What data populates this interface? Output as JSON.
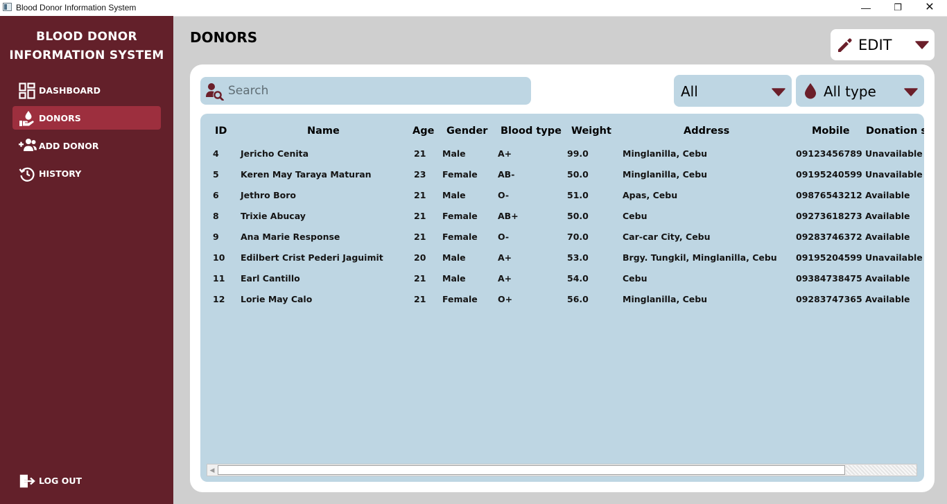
{
  "window": {
    "title": "Blood Donor Information System",
    "minimize_glyph": "—",
    "maximize_glyph": "❐",
    "close_glyph": "✕"
  },
  "sidebar": {
    "brand_line1": "BLOOD DONOR",
    "brand_line2": "INFORMATION SYSTEM",
    "items": [
      {
        "label": "DASHBOARD",
        "icon": "dashboard-icon"
      },
      {
        "label": "DONORS",
        "icon": "donor-hand-icon",
        "active": true
      },
      {
        "label": "ADD DONOR",
        "icon": "add-user-icon"
      },
      {
        "label": "HISTORY",
        "icon": "history-icon"
      }
    ],
    "logout": {
      "label": "LOG OUT",
      "icon": "logout-icon"
    }
  },
  "main": {
    "title": "DONORS",
    "edit": {
      "label": "EDIT",
      "icon": "pencil-icon"
    },
    "search": {
      "placeholder": "Search",
      "value": ""
    },
    "status_filter": {
      "value": "All"
    },
    "blood_filter": {
      "value": "All type",
      "icon": "blood-drop-icon"
    }
  },
  "table": {
    "columns": [
      "ID",
      "Name",
      "Age",
      "Gender",
      "Blood type",
      "Weight",
      "Address",
      "Mobile",
      "Donation s"
    ],
    "rows": [
      [
        "4",
        "Jericho  Cenita",
        "21",
        "Male",
        "A+",
        "99.0",
        "Minglanilla, Cebu",
        "09123456789",
        "Unavailable"
      ],
      [
        "5",
        "Keren May Taraya Maturan",
        "23",
        "Female",
        "AB-",
        "50.0",
        "Minglanilla, Cebu",
        "09195240599",
        "Unavailable"
      ],
      [
        "6",
        "Jethro  Boro",
        "21",
        "Male",
        "O-",
        "51.0",
        "Apas, Cebu",
        "09876543212",
        "Available"
      ],
      [
        "8",
        "Trixie  Abucay",
        "21",
        "Female",
        "AB+",
        "50.0",
        "Cebu",
        "09273618273",
        "Available"
      ],
      [
        "9",
        "Ana Marie  Response",
        "21",
        "Female",
        "O-",
        "70.0",
        "Car-car City, Cebu",
        "09283746372",
        "Available"
      ],
      [
        "10",
        "Edilbert Crist Pederi Jaguimit",
        "20",
        "Male",
        "A+",
        "53.0",
        "Brgy. Tungkil, Minglanilla, Cebu",
        "09195204599",
        "Unavailable"
      ],
      [
        "11",
        "Earl  Cantillo",
        "21",
        "Male",
        "A+",
        "54.0",
        "Cebu",
        "09384738475",
        "Available"
      ],
      [
        "12",
        "Lorie May  Calo",
        "21",
        "Female",
        "O+",
        "56.0",
        "Minglanilla, Cebu",
        "09283747365",
        "Available"
      ]
    ],
    "scrollbar_left_arrow": "◀"
  },
  "colors": {
    "sidebar_bg": "#63202a",
    "active_item": "#9d2f3e",
    "accent_dark_red": "#6b1f2a",
    "table_bg": "#bed6e3",
    "page_bg": "#cfcfcf"
  }
}
